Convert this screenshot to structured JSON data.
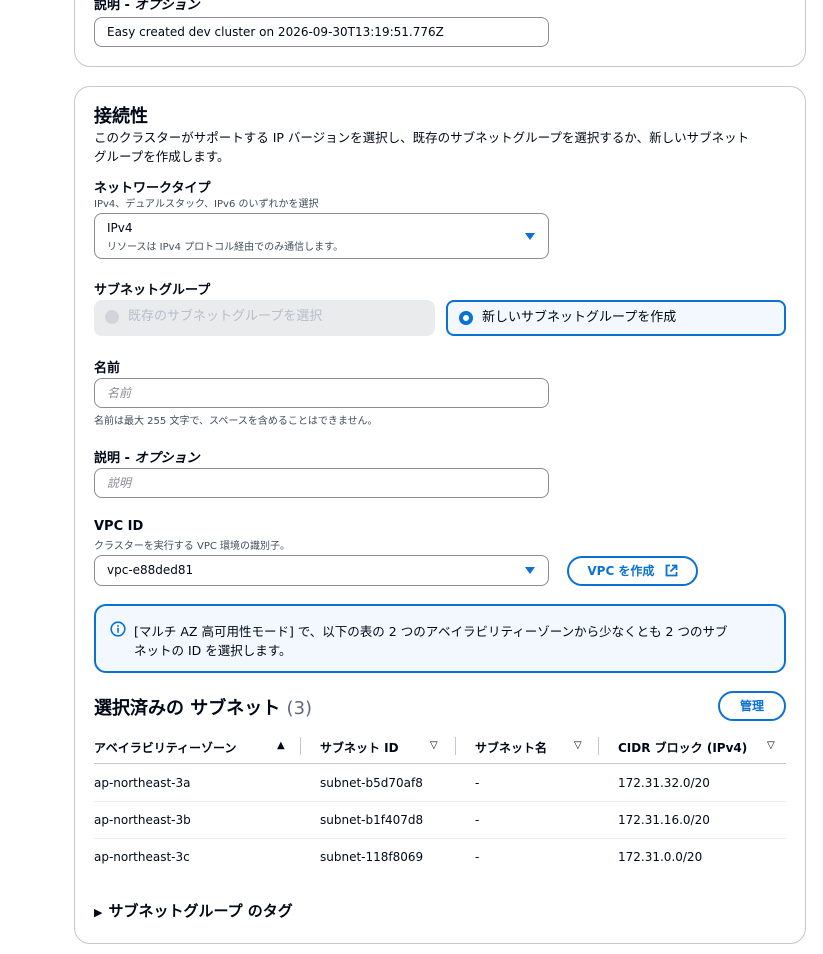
{
  "top_section": {
    "description_label": "説明 - ",
    "description_optional": "オプション",
    "description_value": "Easy created dev cluster on 2026-09-30T13:19:51.776Z"
  },
  "connectivity": {
    "title": "接続性",
    "description_line1": "このクラスターがサポートする IP バージョンを選択し、既存のサブネットグループを選択するか、新しいサブネット",
    "description_line2": "グループを作成します。",
    "network_type": {
      "label": "ネットワークタイプ",
      "hint": "IPv4、デュアルスタック、IPv6 のいずれかを選択",
      "selected_value": "IPv4",
      "selected_description": "リソースは IPv4 プロトコル経由でのみ通信します。"
    },
    "subnet_group": {
      "label": "サブネットグループ",
      "option_existing": "既存のサブネットグループを選択",
      "option_new": "新しいサブネットグループを作成"
    },
    "name": {
      "label": "名前",
      "placeholder": "名前",
      "hint": "名前は最大 255 文字で、スペースを含めることはできません。"
    },
    "description": {
      "label": "説明 - ",
      "label_optional": "オプション",
      "placeholder": "説明"
    },
    "vpc": {
      "label": "VPC ID",
      "hint": "クラスターを実行する VPC 環境の識別子。",
      "selected_value": "vpc-e88ded81",
      "create_button": "VPC を作成"
    },
    "info_alert": {
      "line1": "[マルチ AZ 高可用性モード] で、以下の表の 2 つのアベイラビリティーゾーンから少なくとも 2 つのサブ",
      "line2": "ネットの ID を選択します。"
    },
    "subnets_table": {
      "title": "選択済みの サブネット",
      "count": "(3)",
      "manage_button": "管理",
      "columns": [
        "アベイラビリティーゾーン",
        "サブネット ID",
        "サブネット名",
        "CIDR ブロック (IPv4)"
      ],
      "rows": [
        [
          "ap-northeast-3a",
          "subnet-b5d70af8",
          "-",
          "172.31.32.0/20"
        ],
        [
          "ap-northeast-3b",
          "subnet-b1f407d8",
          "-",
          "172.31.16.0/20"
        ],
        [
          "ap-northeast-3c",
          "subnet-118f8069",
          "-",
          "172.31.0.0/20"
        ]
      ]
    },
    "tags_expander": "サブネットグループ のタグ"
  },
  "colors": {
    "accent": "#0972d3",
    "border": "#8c8c94",
    "disabled_bg": "#e9ebed",
    "info_bg": "#f2f8fd"
  },
  "icons": [
    "caret-down-icon",
    "radio-selected-icon",
    "radio-disabled-icon",
    "external-link-icon",
    "info-icon",
    "sort-ascending-icon",
    "sort-icon",
    "expand-triangle-icon"
  ]
}
